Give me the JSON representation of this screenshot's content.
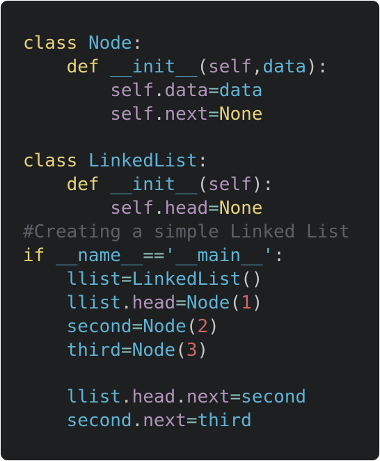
{
  "code": {
    "lines": [
      [
        {
          "t": "class",
          "c": "kw"
        },
        {
          "t": " ",
          "c": "pun"
        },
        {
          "t": "Node",
          "c": "cls"
        },
        {
          "t": ":",
          "c": "pun"
        }
      ],
      [
        {
          "t": "    ",
          "c": "pun"
        },
        {
          "t": "def",
          "c": "kw"
        },
        {
          "t": " ",
          "c": "pun"
        },
        {
          "t": "__init__",
          "c": "fn"
        },
        {
          "t": "(",
          "c": "pun"
        },
        {
          "t": "self",
          "c": "slf"
        },
        {
          "t": ",",
          "c": "pun"
        },
        {
          "t": "data",
          "c": "fn"
        },
        {
          "t": "):",
          "c": "pun"
        }
      ],
      [
        {
          "t": "        ",
          "c": "pun"
        },
        {
          "t": "self",
          "c": "slf"
        },
        {
          "t": ".",
          "c": "pun"
        },
        {
          "t": "data",
          "c": "slf"
        },
        {
          "t": "=",
          "c": "op"
        },
        {
          "t": "data",
          "c": "fn"
        }
      ],
      [
        {
          "t": "        ",
          "c": "pun"
        },
        {
          "t": "self",
          "c": "slf"
        },
        {
          "t": ".",
          "c": "pun"
        },
        {
          "t": "next",
          "c": "slf"
        },
        {
          "t": "=",
          "c": "op"
        },
        {
          "t": "None",
          "c": "cst"
        }
      ],
      [],
      [
        {
          "t": "class",
          "c": "kw"
        },
        {
          "t": " ",
          "c": "pun"
        },
        {
          "t": "LinkedList",
          "c": "cls"
        },
        {
          "t": ":",
          "c": "pun"
        }
      ],
      [
        {
          "t": "    ",
          "c": "pun"
        },
        {
          "t": "def",
          "c": "kw"
        },
        {
          "t": " ",
          "c": "pun"
        },
        {
          "t": "__init__",
          "c": "fn"
        },
        {
          "t": "(",
          "c": "pun"
        },
        {
          "t": "self",
          "c": "slf"
        },
        {
          "t": "):",
          "c": "pun"
        }
      ],
      [
        {
          "t": "        ",
          "c": "pun"
        },
        {
          "t": "self",
          "c": "slf"
        },
        {
          "t": ".",
          "c": "pun"
        },
        {
          "t": "head",
          "c": "slf"
        },
        {
          "t": "=",
          "c": "op"
        },
        {
          "t": "None",
          "c": "cst"
        }
      ],
      [
        {
          "t": "#Creating a simple Linked List",
          "c": "cmt"
        }
      ],
      [
        {
          "t": "if",
          "c": "kw"
        },
        {
          "t": " ",
          "c": "pun"
        },
        {
          "t": "__name__",
          "c": "fn"
        },
        {
          "t": "==",
          "c": "op"
        },
        {
          "t": "'__main__'",
          "c": "str"
        },
        {
          "t": ":",
          "c": "pun"
        }
      ],
      [
        {
          "t": "    ",
          "c": "pun"
        },
        {
          "t": "llist",
          "c": "fn"
        },
        {
          "t": "=",
          "c": "op"
        },
        {
          "t": "LinkedList",
          "c": "fn"
        },
        {
          "t": "()",
          "c": "pun"
        }
      ],
      [
        {
          "t": "    ",
          "c": "pun"
        },
        {
          "t": "llist",
          "c": "fn"
        },
        {
          "t": ".",
          "c": "pun"
        },
        {
          "t": "head",
          "c": "slf"
        },
        {
          "t": "=",
          "c": "op"
        },
        {
          "t": "Node",
          "c": "fn"
        },
        {
          "t": "(",
          "c": "pun"
        },
        {
          "t": "1",
          "c": "num"
        },
        {
          "t": ")",
          "c": "pun"
        }
      ],
      [
        {
          "t": "    ",
          "c": "pun"
        },
        {
          "t": "second",
          "c": "fn"
        },
        {
          "t": "=",
          "c": "op"
        },
        {
          "t": "Node",
          "c": "fn"
        },
        {
          "t": "(",
          "c": "pun"
        },
        {
          "t": "2",
          "c": "num"
        },
        {
          "t": ")",
          "c": "pun"
        }
      ],
      [
        {
          "t": "    ",
          "c": "pun"
        },
        {
          "t": "third",
          "c": "fn"
        },
        {
          "t": "=",
          "c": "op"
        },
        {
          "t": "Node",
          "c": "fn"
        },
        {
          "t": "(",
          "c": "pun"
        },
        {
          "t": "3",
          "c": "num"
        },
        {
          "t": ")",
          "c": "pun"
        }
      ],
      [],
      [
        {
          "t": "    ",
          "c": "pun"
        },
        {
          "t": "llist",
          "c": "fn"
        },
        {
          "t": ".",
          "c": "pun"
        },
        {
          "t": "head",
          "c": "slf"
        },
        {
          "t": ".",
          "c": "pun"
        },
        {
          "t": "next",
          "c": "slf"
        },
        {
          "t": "=",
          "c": "op"
        },
        {
          "t": "second",
          "c": "fn"
        }
      ],
      [
        {
          "t": "    ",
          "c": "pun"
        },
        {
          "t": "second",
          "c": "fn"
        },
        {
          "t": ".",
          "c": "pun"
        },
        {
          "t": "next",
          "c": "slf"
        },
        {
          "t": "=",
          "c": "op"
        },
        {
          "t": "third",
          "c": "fn"
        }
      ]
    ]
  },
  "colors": {
    "background": "#1d1f21",
    "keyword": "#e6d27a",
    "identifier": "#5fb3d4",
    "self_attr": "#b294bb",
    "operator": "#8abeb7",
    "number": "#cc6666",
    "comment": "#5c6166"
  }
}
